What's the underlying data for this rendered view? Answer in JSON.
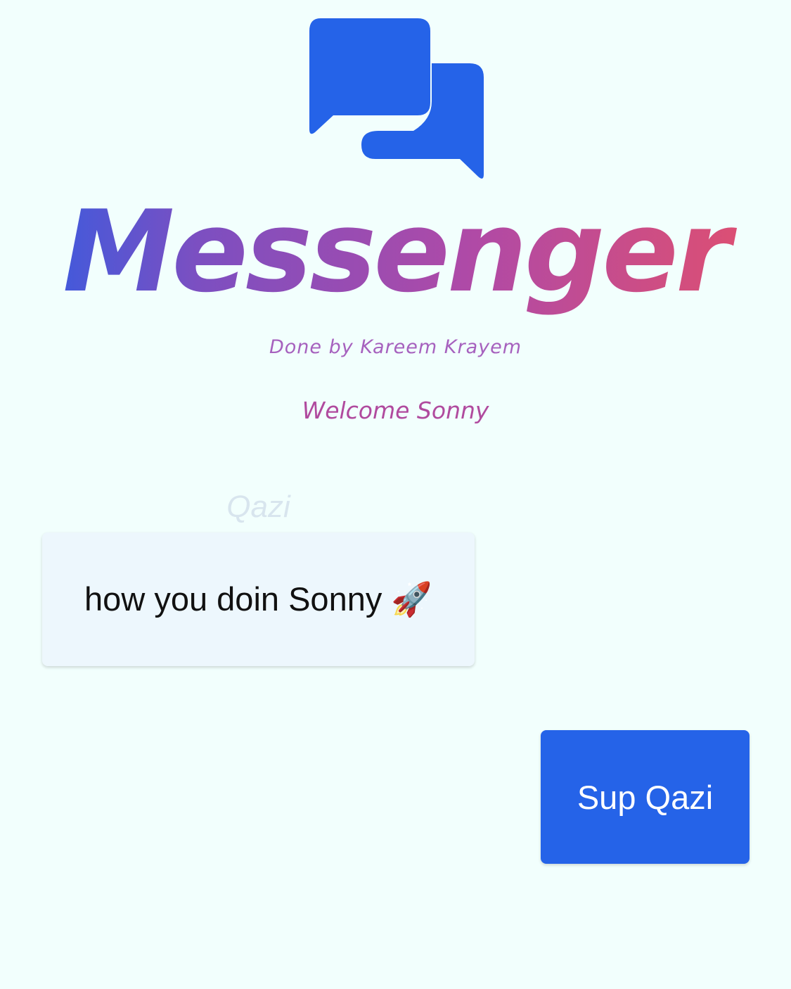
{
  "header": {
    "logo_icon": "chat-bubbles-icon",
    "app_name": "Messenger",
    "credit": "Done by Kareem Krayem",
    "welcome": "Welcome Sonny"
  },
  "messages": [
    {
      "sender": "Qazi",
      "text": "how you doin Sonny 🚀",
      "direction": "incoming"
    },
    {
      "sender": "",
      "text": "Sup Qazi",
      "direction": "outgoing"
    }
  ],
  "colors": {
    "background": "#f2fffd",
    "accent": "#2563e8",
    "incoming_bubble": "#edf7fd",
    "title_gradient": [
      "#2a5ee6",
      "#7c4fc1",
      "#b04aa6",
      "#e4506a"
    ]
  }
}
